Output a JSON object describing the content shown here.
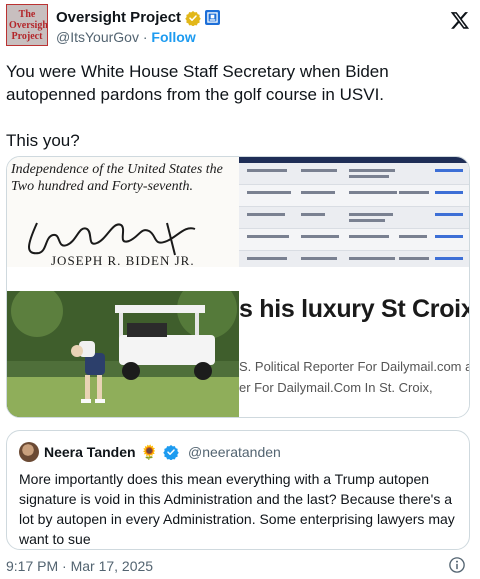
{
  "author": {
    "avatar_text": [
      "The",
      "Oversight",
      "Project"
    ],
    "name": "Oversight Project",
    "handle": "@ItsYourGov",
    "separator": "·",
    "follow_label": "Follow"
  },
  "tweet": {
    "line1": "You were White House Staff Secretary when Biden autopenned pardons from the golf course in USVI.",
    "line2": "This you?"
  },
  "media": {
    "document_text": "Independence of the United States the Two hundred and Forty-seventh.",
    "document_name": "JOSEPH R. BIDEN JR.",
    "article_headline": "s his luxury St Croix v",
    "article_byline_1": "S. Political Reporter For Dailymail.com and",
    "article_byline_2": "er For Dailymail.Com In St. Croix,"
  },
  "quoted_tweet": {
    "name": "Neera Tanden",
    "name_emoji": "🌻",
    "handle": "@neeratanden",
    "text": "More importantly does this mean everything with a Trump autopen signature is void in this Administration and the last?  Because there's a lot by autopen in every Administration.  Some enterprising lawyers may want to sue"
  },
  "footer": {
    "timestamp": "9:17 PM · Mar 17, 2025"
  },
  "colors": {
    "accent": "#1d9bf0",
    "verified_gold": "#e2b719",
    "gov_badge": "#1d6fd8",
    "secondary_text": "#536471"
  },
  "icons": {
    "verified": "verified-gold-badge-icon",
    "government": "government-badge-icon",
    "x_logo": "x-logo-icon",
    "info": "info-icon"
  }
}
